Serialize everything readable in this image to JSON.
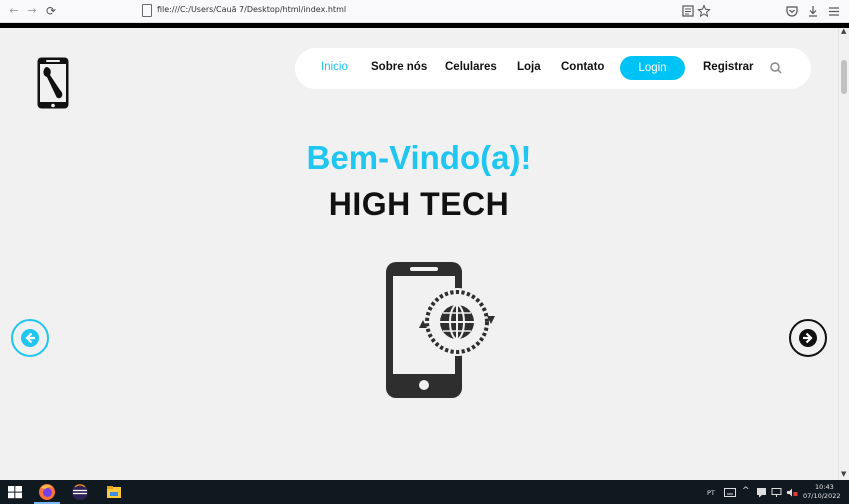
{
  "browser": {
    "back": "←",
    "forward": "→",
    "reload": "⟳",
    "url": "file:///C:/Users/Cauã 7/Desktop/html/index.html",
    "reader_icon": "reader-view-icon",
    "bookmark_icon": "star-icon",
    "pocket_icon": "pocket-icon",
    "download_icon": "download-icon",
    "menu_icon": "hamburger-menu-icon"
  },
  "site": {
    "nav": {
      "items": [
        "Inicio",
        "Sobre nós",
        "Celulares",
        "Loja",
        "Contato"
      ],
      "login": "Login",
      "register": "Registrar"
    },
    "hero": {
      "welcome": "Bem-Vindo(a)!",
      "brand": "HIGH TECH"
    },
    "colors": {
      "accent": "#1ec6f0",
      "login_bg": "#00c3f5",
      "text": "#111111"
    }
  },
  "taskbar": {
    "lang": "PT",
    "time": "10:43",
    "date": "07/10/2022"
  }
}
